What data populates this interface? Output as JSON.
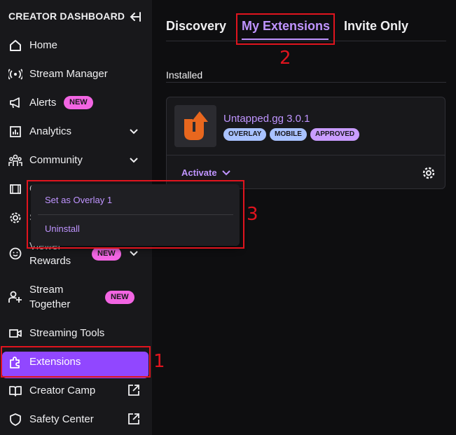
{
  "sidebar": {
    "header": "CREATOR DASHBOARD",
    "items": [
      {
        "label": "Home",
        "icon": "home-icon"
      },
      {
        "label": "Stream Manager",
        "icon": "broadcast-icon"
      },
      {
        "label": "Alerts",
        "icon": "megaphone-icon",
        "badge": "NEW"
      },
      {
        "label": "Analytics",
        "icon": "bar-chart-icon"
      },
      {
        "label": "Community",
        "icon": "people-icon"
      },
      {
        "label": "C",
        "icon": "film-icon"
      },
      {
        "label": "S",
        "icon": "gear-icon"
      },
      {
        "label": "Viewer",
        "label2": "Rewards",
        "icon": "smile-icon",
        "badge": "NEW"
      },
      {
        "label": "Stream",
        "label2": "Together",
        "icon": "user-add-icon",
        "badge": "NEW"
      },
      {
        "label": "Streaming Tools",
        "icon": "camera-icon"
      },
      {
        "label": "Extensions",
        "icon": "puzzle-icon"
      },
      {
        "label": "Creator Camp",
        "icon": "book-icon"
      },
      {
        "label": "Safety Center",
        "icon": "shield-icon"
      }
    ]
  },
  "tabs": [
    "Discovery",
    "My Extensions",
    "Invite Only"
  ],
  "section_label": "Installed",
  "extension": {
    "name": "Untapped.gg 3.0.1",
    "tags": [
      "OVERLAY",
      "MOBILE",
      "APPROVED"
    ],
    "activate_label": "Activate"
  },
  "dropdown": {
    "items": [
      "Set as Overlay 1",
      "Uninstall"
    ]
  },
  "annotations": [
    "1",
    "2",
    "3"
  ],
  "colors": {
    "accent": "#9147ff",
    "accent_light": "#bf94ff",
    "badge_new": "#f265e3",
    "annotation": "#e0141e"
  }
}
